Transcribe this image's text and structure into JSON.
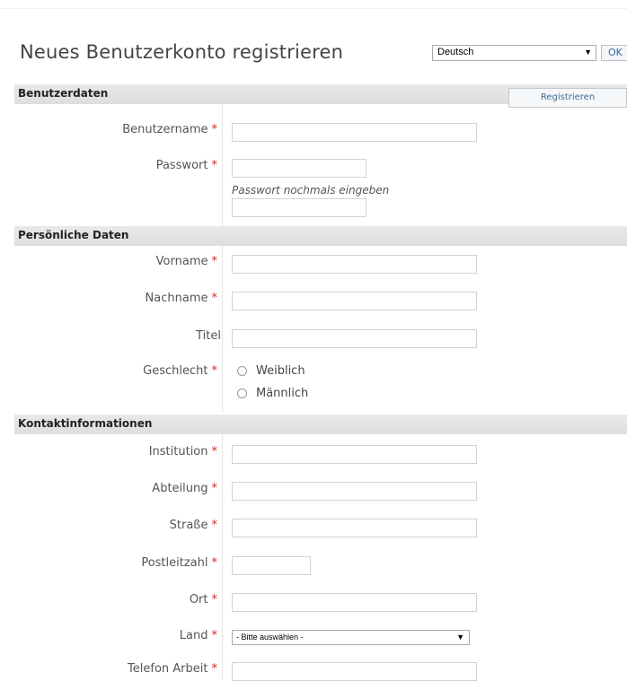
{
  "header": {
    "title": "Neues Benutzerkonto registrieren",
    "language": "Deutsch",
    "ok_label": "OK"
  },
  "sections": {
    "account": "Benutzerdaten",
    "personal": "Persönliche Daten",
    "contact": "Kontaktinformationen"
  },
  "register_label": "Registrieren",
  "required_mark": "*",
  "fields": {
    "username": "Benutzername",
    "password": "Passwort",
    "password_repeat_hint": "Passwort nochmals eingeben",
    "firstname": "Vorname",
    "lastname": "Nachname",
    "title": "Titel",
    "gender": "Geschlecht",
    "gender_female": "Weiblich",
    "gender_male": "Männlich",
    "institution": "Institution",
    "department": "Abteilung",
    "street": "Straße",
    "zip": "Postleitzahl",
    "city": "Ort",
    "country": "Land",
    "country_placeholder": "- Bitte auswählen -",
    "phone_work": "Telefon Arbeit"
  },
  "icons": {
    "dropdown": "chevron-down-icon",
    "radio": "radio-icon"
  }
}
